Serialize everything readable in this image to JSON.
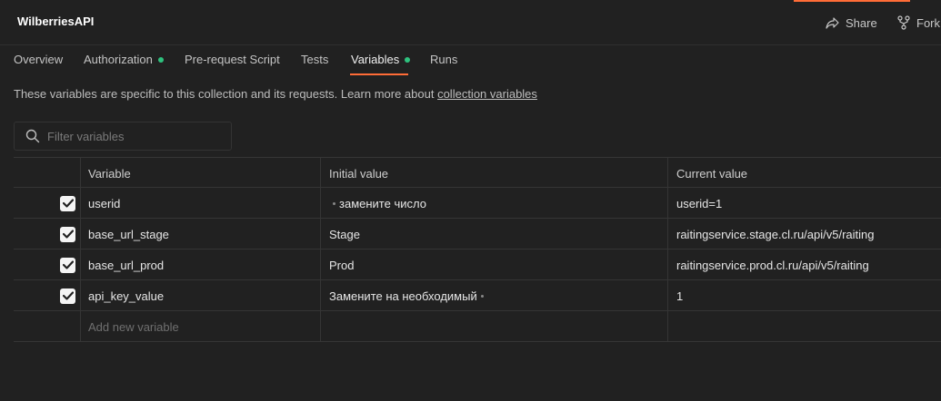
{
  "header": {
    "title": "WilberriesAPI",
    "share_label": "Share",
    "fork_label": "Fork",
    "accent": "#ff6c37"
  },
  "tabs": [
    {
      "label": "Overview"
    },
    {
      "label": "Authorization",
      "dot": true
    },
    {
      "label": "Pre-request Script"
    },
    {
      "label": "Tests"
    },
    {
      "label": "Variables",
      "dot": true,
      "active": true
    },
    {
      "label": "Runs"
    }
  ],
  "description": {
    "text": "These variables are specific to this collection and its requests. Learn more about ",
    "link": "collection variables"
  },
  "filter": {
    "placeholder": "Filter variables"
  },
  "table": {
    "headers": {
      "variable": "Variable",
      "initial": "Initial value",
      "current": "Current value"
    },
    "rows": [
      {
        "checked": true,
        "variable": "userid",
        "initial": "замените число",
        "current": "userid=1"
      },
      {
        "checked": true,
        "variable": "base_url_stage",
        "initial": "Stage",
        "current": "raitingservice.stage.cl.ru/api/v5/raiting"
      },
      {
        "checked": true,
        "variable": "base_url_prod",
        "initial": "Prod",
        "current": "raitingservice.prod.cl.ru/api/v5/raiting"
      },
      {
        "checked": true,
        "variable": "api_key_value",
        "initial": "Замените на необходимый",
        "current": "1"
      }
    ],
    "add_placeholder": "Add new variable"
  },
  "colors": {
    "background": "#212121",
    "status_dot": "#2ec27e",
    "border": "#353535"
  }
}
